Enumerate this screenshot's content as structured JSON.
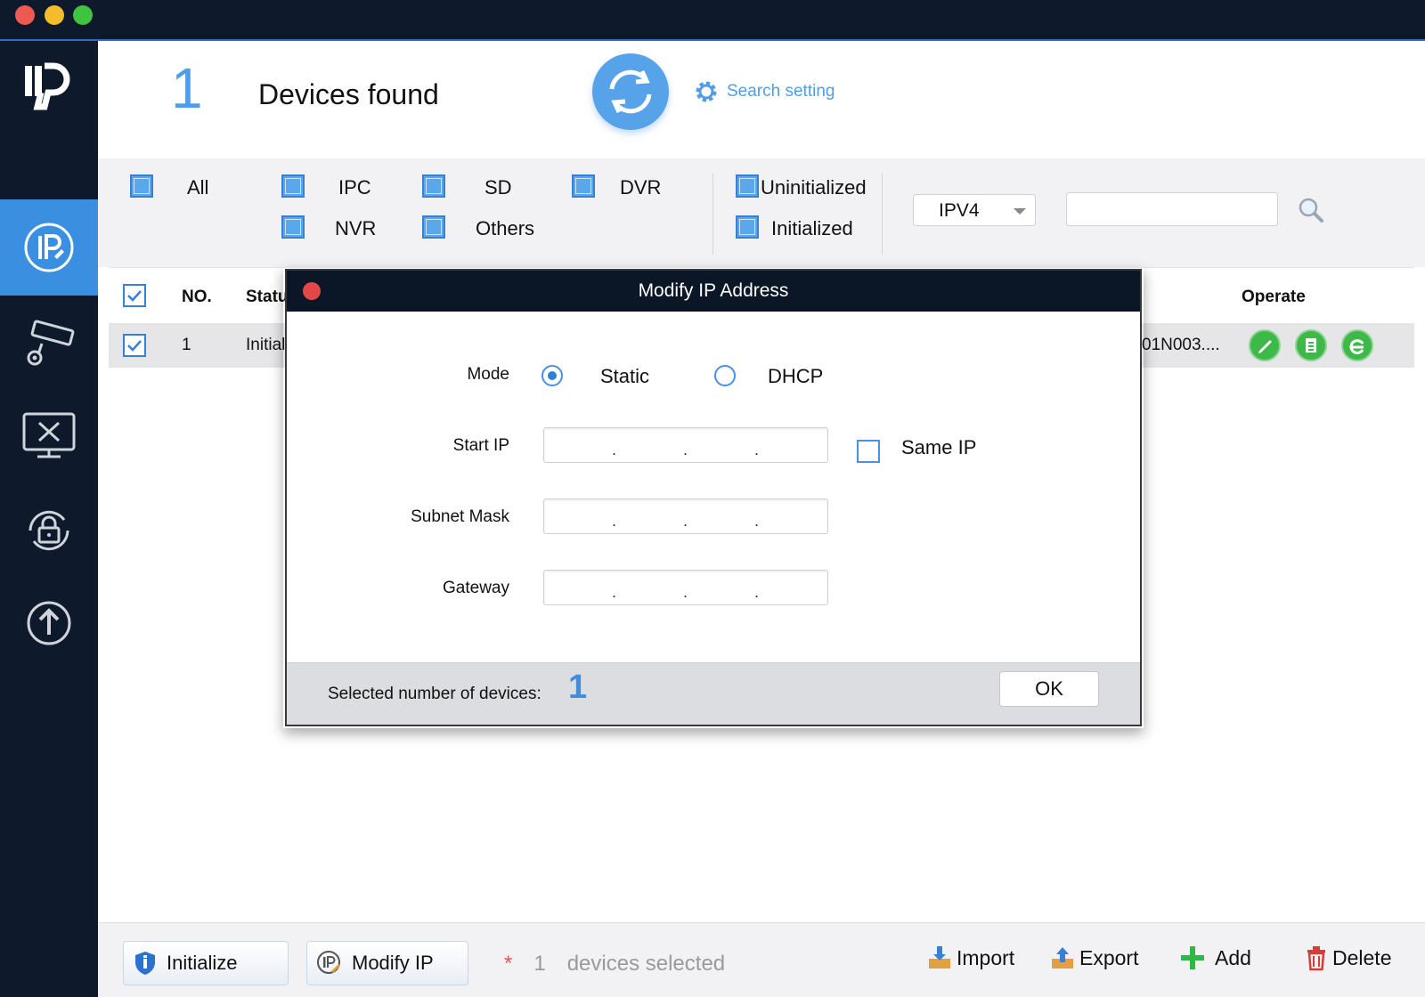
{
  "header": {
    "device_count": "1",
    "found_label": "Devices found",
    "search_setting": "Search setting"
  },
  "filters": {
    "types": [
      "All",
      "IPC",
      "SD",
      "DVR",
      "NVR",
      "Others"
    ],
    "status": [
      "Uninitialized",
      "Initialized"
    ],
    "ip_version": "IPV4",
    "search_value": ""
  },
  "table": {
    "columns": {
      "no": "NO.",
      "status": "Statu",
      "operate": "Operate"
    },
    "rows": [
      {
        "no": "1",
        "status": "Initial",
        "model": "01N003...."
      }
    ]
  },
  "dialog": {
    "title": "Modify IP Address",
    "mode_label": "Mode",
    "mode_static": "Static",
    "mode_dhcp": "DHCP",
    "start_ip_label": "Start IP",
    "subnet_label": "Subnet Mask",
    "gateway_label": "Gateway",
    "same_ip_label": "Same IP",
    "ip_dot": ".",
    "selected_label": "Selected number of devices:",
    "selected_count": "1",
    "ok_label": "OK"
  },
  "bottom": {
    "initialize": "Initialize",
    "modify_ip": "Modify IP",
    "star": "*",
    "selected_count": "1",
    "selected_suffix": "devices selected",
    "import": "Import",
    "export": "Export",
    "add": "Add",
    "delete": "Delete"
  },
  "colors": {
    "accent": "#3b8fe0",
    "sidebar": "#0e1a2b",
    "operate_green": "#3fb84a",
    "star_red": "#e05555"
  }
}
